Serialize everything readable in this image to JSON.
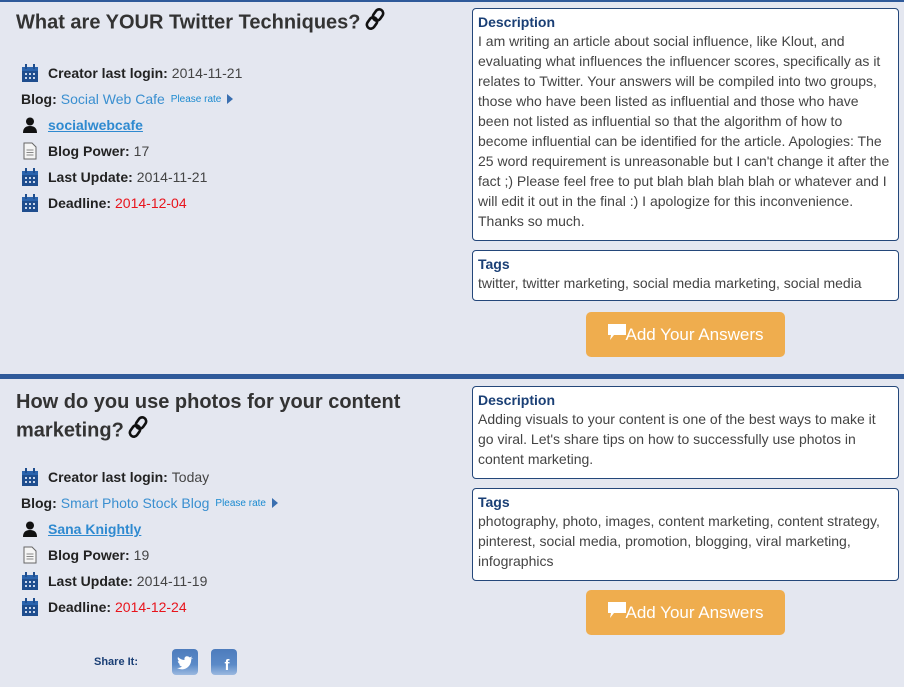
{
  "questions": [
    {
      "title": "What are YOUR Twitter Techniques?",
      "meta": {
        "creator_last_login_label": "Creator last login:",
        "creator_last_login": "2014-11-21",
        "blog_label": "Blog:",
        "blog_name": "Social Web Cafe",
        "please_rate": "Please rate",
        "username": "socialwebcafe",
        "blog_power_label": "Blog Power:",
        "blog_power": "17",
        "last_update_label": "Last Update:",
        "last_update": "2014-11-21",
        "deadline_label": "Deadline:",
        "deadline": "2014-12-04"
      },
      "description_title": "Description",
      "description": "I am writing an article about social influence, like Klout, and evaluating what influences the influencer scores, specifically as it relates to Twitter. Your answers will be compiled into two groups, those who have been listed as influential and those who have been not listed as influential so that the algorithm of how to become influential can be identified for the article. Apologies: The 25 word requirement is unreasonable but I can't change it after the fact ;) Please feel free to put blah blah blah blah or whatever and I will edit it out in the final :) I apologize for this inconvenience. Thanks so much.",
      "tags_title": "Tags",
      "tags": "twitter, twitter marketing, social media marketing, social media",
      "button_label": "Add Your Answers"
    },
    {
      "title": "How do you use photos for your content marketing?",
      "meta": {
        "creator_last_login_label": "Creator last login:",
        "creator_last_login": "Today",
        "blog_label": "Blog:",
        "blog_name": "Smart Photo Stock Blog",
        "please_rate": "Please rate",
        "username": "Sana Knightly",
        "blog_power_label": "Blog Power:",
        "blog_power": "19",
        "last_update_label": "Last Update:",
        "last_update": "2014-11-19",
        "deadline_label": "Deadline:",
        "deadline": "2014-12-24"
      },
      "description_title": "Description",
      "description": "Adding visuals to your content is one of the best ways to make it go viral. Let's share tips on how to successfully use photos in content marketing.",
      "tags_title": "Tags",
      "tags": "photography, photo, images, content marketing, content strategy, pinterest, social media, promotion, blogging, viral marketing, infographics",
      "button_label": "Add Your Answers"
    }
  ],
  "share": {
    "label": "Share It:",
    "icons": [
      "twitter-icon",
      "facebook-icon"
    ]
  },
  "colors": {
    "accent": "#2f5a9a",
    "button": "#efad4e",
    "deadline": "#e8141c",
    "link": "#3a8fd0"
  }
}
